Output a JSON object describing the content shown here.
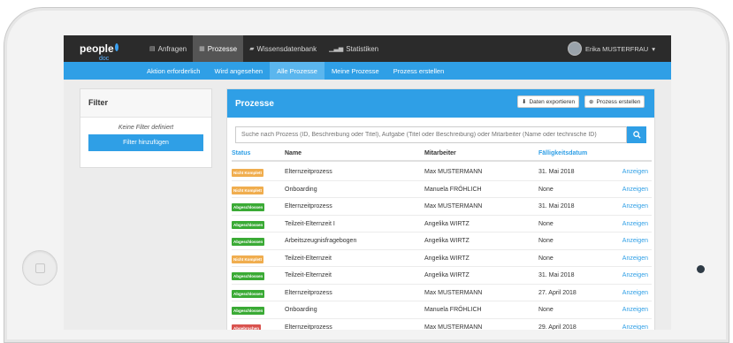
{
  "colors": {
    "accent": "#2f9fe6",
    "topbar": "#2b2b2b",
    "open": "#f0ad4e",
    "done": "#3aaa35",
    "cancelled": "#d9534f"
  },
  "app": {
    "logo_text": "people",
    "logo_sub": "doc"
  },
  "nav": {
    "items": [
      {
        "label": "Anfragen",
        "icon": "inbox-icon"
      },
      {
        "label": "Prozesse",
        "icon": "process-icon",
        "active": true
      },
      {
        "label": "Wissensdatenbank",
        "icon": "book-icon"
      },
      {
        "label": "Statistiken",
        "icon": "bar-chart-icon"
      }
    ],
    "user": "Erika MUSTERFRAU"
  },
  "subnav": {
    "items": [
      {
        "label": "Aktion erforderlich"
      },
      {
        "label": "Wird angesehen"
      },
      {
        "label": "Alle Prozesse",
        "active": true
      },
      {
        "label": "Meine Prozesse"
      },
      {
        "label": "Prozess erstellen"
      }
    ]
  },
  "filter": {
    "title": "Filter",
    "empty_text": "Keine Filter definiert",
    "add_button": "Filter hinzufügen"
  },
  "panel": {
    "title": "Prozesse",
    "export_button": "Daten exportieren",
    "create_button": "Prozess erstellen",
    "search_placeholder": "Suche nach Prozess (ID, Beschreibung oder Titel), Aufgabe (Titel oder Beschreibung) oder Mitarbeiter (Name oder technische ID)"
  },
  "table": {
    "columns": [
      "Status",
      "Name",
      "Mitarbeiter",
      "Fälligkeitsdatum"
    ],
    "rows": [
      {
        "status": "Nicht Komplett",
        "status_type": "open",
        "name": "Elternzeitprozess",
        "employee": "Max MUSTERMANN",
        "due": "31. Mai 2018",
        "action": "Anzeigen"
      },
      {
        "status": "Nicht Komplett",
        "status_type": "open",
        "name": "Onboarding",
        "employee": "Manuela FRÖHLICH",
        "due": "None",
        "action": "Anzeigen"
      },
      {
        "status": "Abgeschlossen",
        "status_type": "done",
        "name": "Elternzeitprozess",
        "employee": "Max MUSTERMANN",
        "due": "31. Mai 2018",
        "action": "Anzeigen"
      },
      {
        "status": "Abgeschlossen",
        "status_type": "done",
        "name": "Teilzeit-Elternzeit I",
        "employee": "Angelika WIRTZ",
        "due": "None",
        "action": "Anzeigen"
      },
      {
        "status": "Abgeschlossen",
        "status_type": "done",
        "name": "Arbeitszeugnisfragebogen",
        "employee": "Angelika WIRTZ",
        "due": "None",
        "action": "Anzeigen"
      },
      {
        "status": "Nicht Komplett",
        "status_type": "open",
        "name": "Teilzeit-Elternzeit",
        "employee": "Angelika WIRTZ",
        "due": "None",
        "action": "Anzeigen"
      },
      {
        "status": "Abgeschlossen",
        "status_type": "done",
        "name": "Teilzeit-Elternzeit",
        "employee": "Angelika WIRTZ",
        "due": "31. Mai 2018",
        "action": "Anzeigen"
      },
      {
        "status": "Abgeschlossen",
        "status_type": "done",
        "name": "Elternzeitprozess",
        "employee": "Max MUSTERMANN",
        "due": "27. April 2018",
        "action": "Anzeigen"
      },
      {
        "status": "Abgeschlossen",
        "status_type": "done",
        "name": "Onboarding",
        "employee": "Manuela FRÖHLICH",
        "due": "None",
        "action": "Anzeigen"
      },
      {
        "status": "Abgebrochen",
        "status_type": "cancelled",
        "name": "Elternzeitprozess",
        "employee": "Max MUSTERMANN",
        "due": "29. April 2018",
        "action": "Anzeigen"
      }
    ]
  }
}
